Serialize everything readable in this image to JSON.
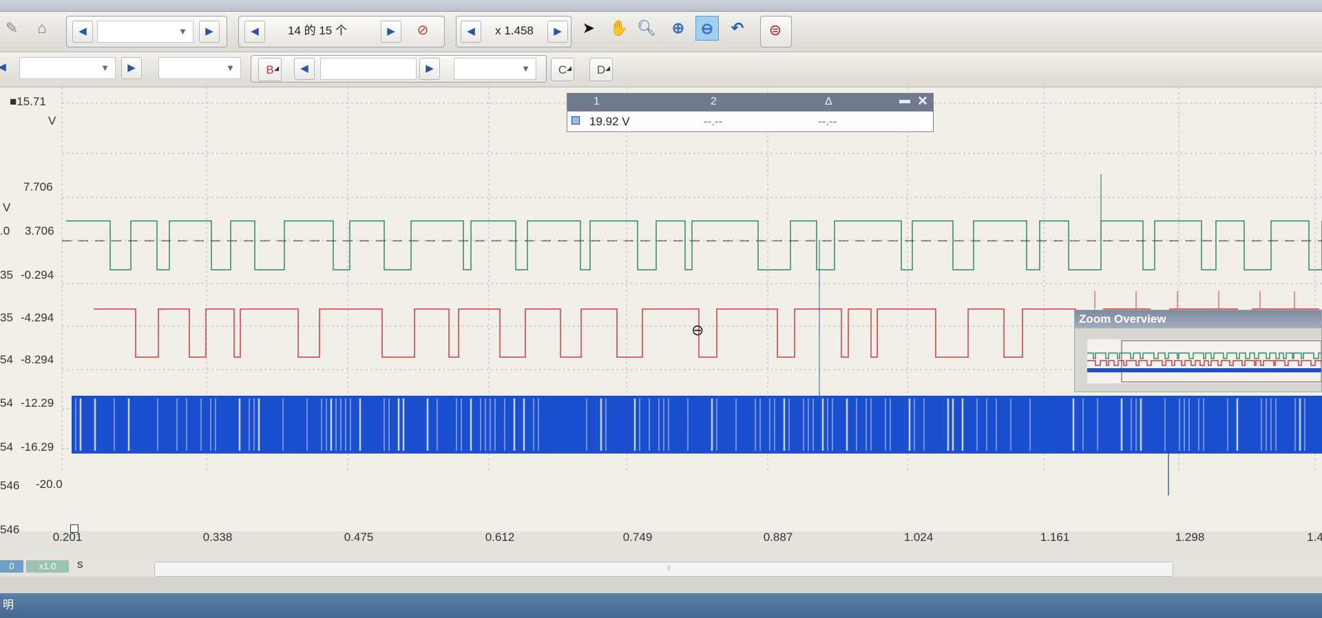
{
  "toolbar1": {
    "page_counter": "14 的 15 个",
    "zoom_value": "x 1.458"
  },
  "toolbar2": {
    "channel_b": "B",
    "channel_c": "C",
    "channel_d": "D"
  },
  "scope": {
    "y_labels_a": [
      "■15.71",
      "V",
      "7.706",
      "V",
      "3.706",
      "-0.294",
      "-4.294",
      "-8.294",
      "-12.29",
      "-16.29",
      "-20.0"
    ],
    "y_labels_b": [
      ".0",
      "35",
      "35",
      "54",
      "54",
      "54",
      "546",
      "546"
    ],
    "x_labels": [
      "0.201",
      "0.338",
      "0.475",
      "0.612",
      "0.749",
      "0.887",
      "1.024",
      "1.161",
      "1.298",
      "1.4"
    ],
    "x_unit": "s",
    "colors": {
      "green": "#2e8b63",
      "red": "#d23a3a",
      "blue": "#1a4fcf",
      "grid": "#a9b8c6"
    }
  },
  "measurement": {
    "col1": "1",
    "col2": "2",
    "col3": "Δ",
    "val1": "19.92 V",
    "val2": "--.--",
    "val3": "--.--"
  },
  "zoom_overview": {
    "title": "Zoom Overview"
  },
  "bottom": {
    "unit_a": "0",
    "unit_b": "x1.0"
  },
  "status": {
    "text": "明"
  },
  "icons": [
    "pencil-icon",
    "home-icon",
    "compass-icon",
    "pointer-icon",
    "hand-icon",
    "zoom-icon",
    "zoom-in-icon",
    "zoom-out-icon",
    "undo-icon",
    "zoom-reset-icon"
  ]
}
